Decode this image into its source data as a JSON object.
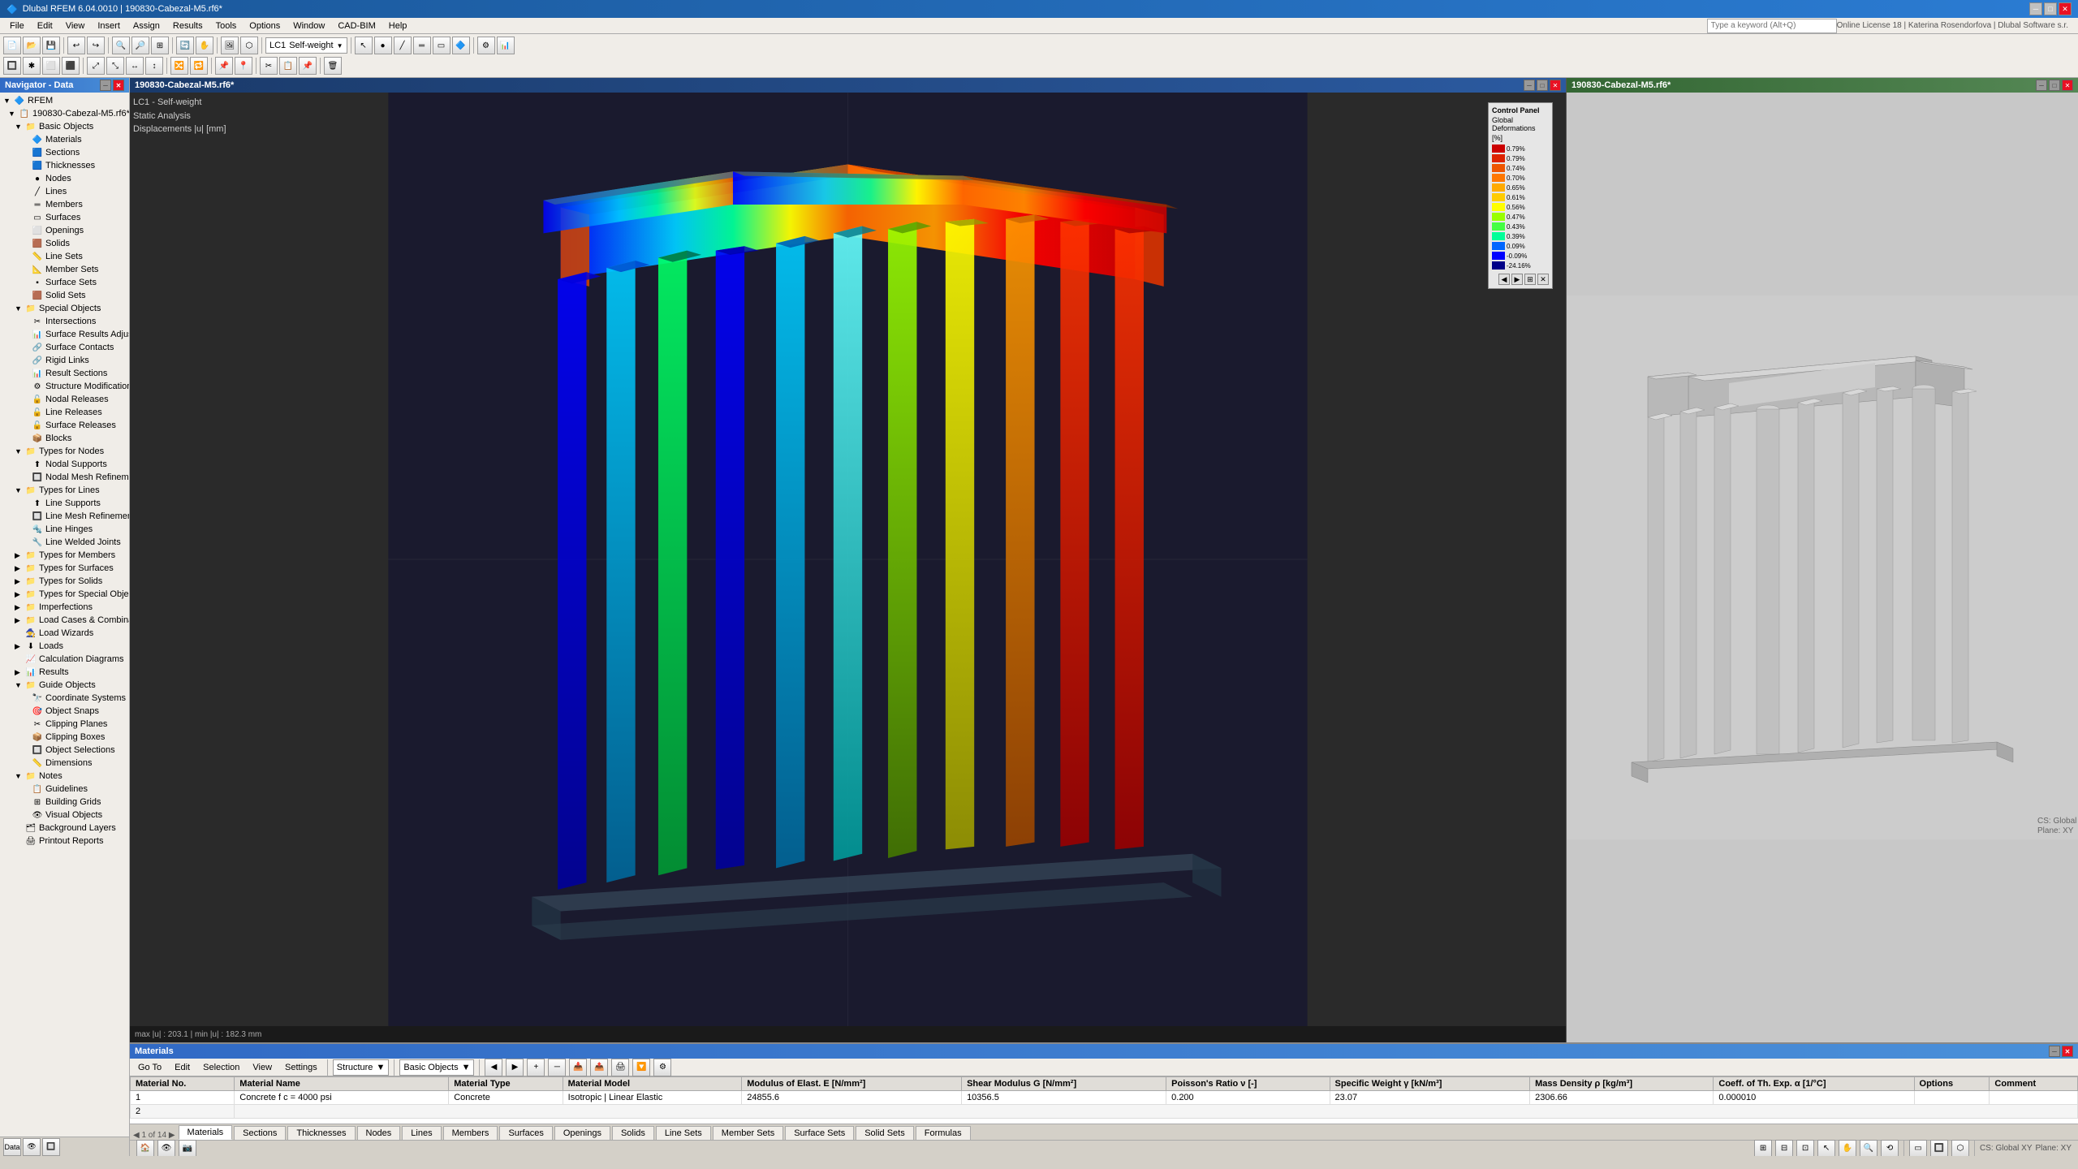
{
  "app": {
    "title": "Dlubal RFEM 6.04.0010 | 190830-Cabezal-M5.rf6*",
    "icon": "🔵"
  },
  "menu": {
    "items": [
      "File",
      "Edit",
      "View",
      "Insert",
      "Assign",
      "Results",
      "Tools",
      "Options",
      "Window",
      "CAD-BIM",
      "Help"
    ]
  },
  "toolbar": {
    "dropdown1": "LC1",
    "dropdown2": "Self-weight"
  },
  "top_right": {
    "search_placeholder": "Type a keyword (Alt+Q)",
    "license": "Online License 18 | Katerina Rosendorfova | Dlubal Software s.r."
  },
  "navigator": {
    "title": "Navigator - Data",
    "rfem_label": "RFEM",
    "file_label": "190830-Cabezal-M5.rf6*",
    "tree": [
      {
        "id": "basic-objects",
        "label": "Basic Objects",
        "level": 1,
        "expanded": true,
        "icon": "📁"
      },
      {
        "id": "materials",
        "label": "Materials",
        "level": 2,
        "icon": "🔷"
      },
      {
        "id": "sections",
        "label": "Sections",
        "level": 2,
        "icon": "🟦"
      },
      {
        "id": "thicknesses",
        "label": "Thicknesses",
        "level": 2,
        "icon": "🟦"
      },
      {
        "id": "nodes",
        "label": "Nodes",
        "level": 2,
        "icon": "🔵"
      },
      {
        "id": "lines",
        "label": "Lines",
        "level": 2,
        "icon": "📏"
      },
      {
        "id": "members",
        "label": "Members",
        "level": 2,
        "icon": "📐"
      },
      {
        "id": "surfaces",
        "label": "Surfaces",
        "level": 2,
        "icon": "▪"
      },
      {
        "id": "openings",
        "label": "Openings",
        "level": 2,
        "icon": "⬜"
      },
      {
        "id": "solids",
        "label": "Solids",
        "level": 2,
        "icon": "🟫"
      },
      {
        "id": "line-sets",
        "label": "Line Sets",
        "level": 2,
        "icon": "📏"
      },
      {
        "id": "member-sets",
        "label": "Member Sets",
        "level": 2,
        "icon": "📐"
      },
      {
        "id": "surface-sets",
        "label": "Surface Sets",
        "level": 2,
        "icon": "▪"
      },
      {
        "id": "solid-sets",
        "label": "Solid Sets",
        "level": 2,
        "icon": "🟫"
      },
      {
        "id": "special-objects",
        "label": "Special Objects",
        "level": 1,
        "expanded": true,
        "icon": "📁"
      },
      {
        "id": "intersections",
        "label": "Intersections",
        "level": 2,
        "icon": "✂️"
      },
      {
        "id": "surface-results-adj",
        "label": "Surface Results Adjustments",
        "level": 2,
        "icon": "📊"
      },
      {
        "id": "surface-contacts",
        "label": "Surface Contacts",
        "level": 2,
        "icon": "🔗"
      },
      {
        "id": "rigid-links",
        "label": "Rigid Links",
        "level": 2,
        "icon": "🔗"
      },
      {
        "id": "result-sections",
        "label": "Result Sections",
        "level": 2,
        "icon": "📊"
      },
      {
        "id": "structure-mods",
        "label": "Structure Modifications",
        "level": 2,
        "icon": "⚙"
      },
      {
        "id": "nodal-releases",
        "label": "Nodal Releases",
        "level": 2,
        "icon": "🔓"
      },
      {
        "id": "line-releases",
        "label": "Line Releases",
        "level": 2,
        "icon": "🔓"
      },
      {
        "id": "surface-releases",
        "label": "Surface Releases",
        "level": 2,
        "icon": "🔓"
      },
      {
        "id": "blocks",
        "label": "Blocks",
        "level": 2,
        "icon": "📦"
      },
      {
        "id": "types-for-nodes",
        "label": "Types for Nodes",
        "level": 1,
        "expanded": true,
        "icon": "📁"
      },
      {
        "id": "nodal-supports",
        "label": "Nodal Supports",
        "level": 2,
        "icon": "⬆"
      },
      {
        "id": "nodal-mesh-ref",
        "label": "Nodal Mesh Refinements",
        "level": 2,
        "icon": "🔲"
      },
      {
        "id": "types-for-lines",
        "label": "Types for Lines",
        "level": 1,
        "expanded": true,
        "icon": "📁"
      },
      {
        "id": "line-supports",
        "label": "Line Supports",
        "level": 2,
        "icon": "⬆"
      },
      {
        "id": "line-mesh-ref",
        "label": "Line Mesh Refinements",
        "level": 2,
        "icon": "🔲"
      },
      {
        "id": "line-hinges",
        "label": "Line Hinges",
        "level": 2,
        "icon": "🔩"
      },
      {
        "id": "line-welded-joints",
        "label": "Line Welded Joints",
        "level": 2,
        "icon": "🔧"
      },
      {
        "id": "types-for-members",
        "label": "Types for Members",
        "level": 1,
        "icon": "📁"
      },
      {
        "id": "types-for-surfaces",
        "label": "Types for Surfaces",
        "level": 1,
        "icon": "📁"
      },
      {
        "id": "types-for-solids",
        "label": "Types for Solids",
        "level": 1,
        "icon": "📁"
      },
      {
        "id": "types-for-special",
        "label": "Types for Special Objects",
        "level": 1,
        "icon": "📁"
      },
      {
        "id": "imperfections",
        "label": "Imperfections",
        "level": 1,
        "icon": "📁"
      },
      {
        "id": "load-cases",
        "label": "Load Cases & Combinations",
        "level": 1,
        "icon": "📁"
      },
      {
        "id": "load-wizards",
        "label": "Load Wizards",
        "level": 1,
        "icon": "🧙"
      },
      {
        "id": "loads",
        "label": "Loads",
        "level": 1,
        "icon": "⬇"
      },
      {
        "id": "calc-diagrams",
        "label": "Calculation Diagrams",
        "level": 1,
        "icon": "📈"
      },
      {
        "id": "results",
        "label": "Results",
        "level": 1,
        "icon": "📊"
      },
      {
        "id": "guide-objects",
        "label": "Guide Objects",
        "level": 1,
        "expanded": true,
        "icon": "📁"
      },
      {
        "id": "coord-systems",
        "label": "Coordinate Systems",
        "level": 2,
        "icon": "🔭"
      },
      {
        "id": "object-snaps",
        "label": "Object Snaps",
        "level": 2,
        "icon": "🎯"
      },
      {
        "id": "clipping-planes",
        "label": "Clipping Planes",
        "level": 2,
        "icon": "✂️"
      },
      {
        "id": "clipping-boxes",
        "label": "Clipping Boxes",
        "level": 2,
        "icon": "📦"
      },
      {
        "id": "object-selections",
        "label": "Object Selections",
        "level": 2,
        "icon": "🔲"
      },
      {
        "id": "dimensions",
        "label": "Dimensions",
        "level": 2,
        "icon": "📏"
      },
      {
        "id": "notes",
        "label": "Notes",
        "level": 1,
        "expanded": true,
        "icon": "📁"
      },
      {
        "id": "guidelines",
        "label": "Guidelines",
        "level": 2,
        "icon": "📋"
      },
      {
        "id": "building-grids",
        "label": "Building Grids",
        "level": 2,
        "icon": "⊞"
      },
      {
        "id": "visual-objects",
        "label": "Visual Objects",
        "level": 2,
        "icon": "👁"
      },
      {
        "id": "background-layers",
        "label": "Background Layers",
        "level": 1,
        "icon": "🗂"
      },
      {
        "id": "printout-reports",
        "label": "Printout Reports",
        "level": 1,
        "icon": "🖨"
      }
    ]
  },
  "viewport_left": {
    "title": "190830-Cabezal-M5.rf6*",
    "subtitle1": "LC1 - Self-weight",
    "subtitle2": "Static Analysis",
    "subtitle3": "Displacements |u| [mm]",
    "status": "max |u| : 203.1 | min |u| : 182.3 mm",
    "color_panel": {
      "title": "Control Panel",
      "subtitle": "Global Deformations",
      "unit": "[%]",
      "entries": [
        {
          "value": "0.79%",
          "color": "#cc0000"
        },
        {
          "value": "0.79%",
          "color": "#dd2200"
        },
        {
          "value": "0.74%",
          "color": "#ee4400"
        },
        {
          "value": "0.70%",
          "color": "#ff6600"
        },
        {
          "value": "0.65%",
          "color": "#ffaa00"
        },
        {
          "value": "0.61%",
          "color": "#ffcc00"
        },
        {
          "value": "0.56%",
          "color": "#ffff00"
        },
        {
          "value": "0.47%",
          "color": "#ccff00"
        },
        {
          "value": "0.43%",
          "color": "#66ff00"
        },
        {
          "value": "0.39%",
          "color": "#00ff66"
        },
        {
          "value": "0.09%",
          "color": "#0066ff"
        },
        {
          "value": "-0.09%",
          "color": "#0000ff"
        },
        {
          "value": "-24.16%",
          "color": "#000099"
        }
      ]
    }
  },
  "viewport_right": {
    "title": "190830-Cabezal-M5.rf6*"
  },
  "bottom_panel": {
    "title": "Materials",
    "toolbar": {
      "goto": "Go To",
      "edit": "Edit",
      "selection": "Selection",
      "view": "View",
      "settings": "Settings",
      "dropdown1": "Structure",
      "dropdown2": "Basic Objects"
    },
    "table": {
      "headers": [
        "Material No.",
        "Material Name",
        "Material Type",
        "Material Model",
        "Modulus of Elast. E [N/mm²]",
        "Shear Modulus G [N/mm²]",
        "Poisson's Ratio ν [-]",
        "Specific Weight γ [kN/m³]",
        "Mass Density ρ [kg/m³]",
        "Coeff. of Th. Exp. α [1/°C]",
        "Options",
        "Comment"
      ],
      "rows": [
        {
          "no": "1",
          "name": "Concrete f c = 4000 psi",
          "type": "Concrete",
          "model": "Isotropic | Linear Elastic",
          "E": "24855.6",
          "G": "10356.5",
          "nu": "0.200",
          "gamma": "23.07",
          "rho": "2306.66",
          "alpha": "0.000010",
          "options": "",
          "comment": ""
        }
      ]
    },
    "tabs": [
      "Materials",
      "Sections",
      "Thicknesses",
      "Nodes",
      "Lines",
      "Members",
      "Surfaces",
      "Openings",
      "Solids",
      "Line Sets",
      "Member Sets",
      "Surface Sets",
      "Solid Sets",
      "Formulas"
    ]
  },
  "status_bar": {
    "plane": "CS: Global XY",
    "view": "Plane: XY"
  }
}
